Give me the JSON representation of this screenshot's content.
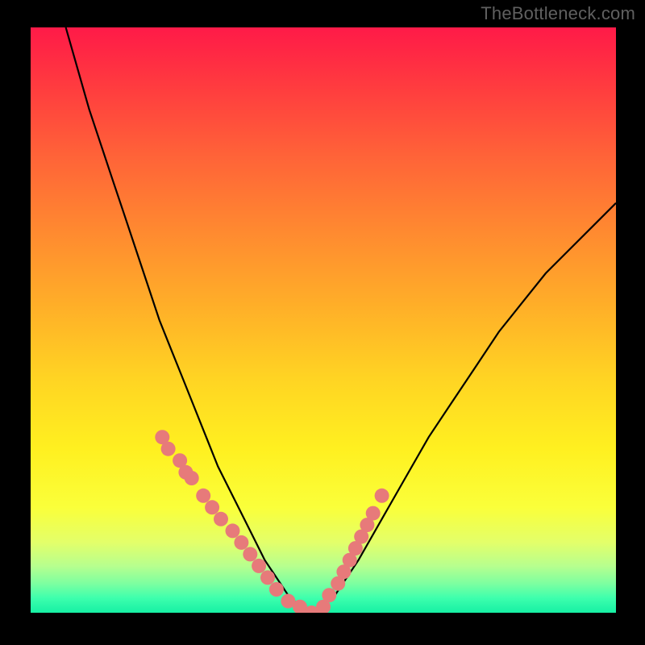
{
  "watermark": "TheBottleneck.com",
  "colors": {
    "background": "#000000",
    "curve_stroke": "#000000",
    "marker_fill": "#e77a7a",
    "gradient_top": "#ff1a48",
    "gradient_bottom": "#16f0a4"
  },
  "chart_data": {
    "type": "line",
    "title": "",
    "xlabel": "",
    "ylabel": "",
    "xlim": [
      0,
      100
    ],
    "ylim": [
      0,
      100
    ],
    "series": [
      {
        "name": "bottleneck-curve",
        "x": [
          6,
          8,
          10,
          12,
          14,
          16,
          18,
          20,
          22,
          24,
          26,
          28,
          30,
          32,
          34,
          36,
          38,
          40,
          42,
          44,
          46,
          48,
          52,
          56,
          60,
          64,
          68,
          72,
          76,
          80,
          84,
          88,
          92,
          96,
          100
        ],
        "y": [
          100,
          93,
          86,
          80,
          74,
          68,
          62,
          56,
          50,
          45,
          40,
          35,
          30,
          25,
          21,
          17,
          13,
          9,
          6,
          3,
          1,
          0,
          3,
          9,
          16,
          23,
          30,
          36,
          42,
          48,
          53,
          58,
          62,
          66,
          70
        ]
      }
    ],
    "markers": {
      "name": "highlighted-points",
      "x": [
        22.5,
        23.5,
        25.5,
        26.5,
        27.5,
        29.5,
        31.0,
        32.5,
        34.5,
        36.0,
        37.5,
        39.0,
        40.5,
        42.0,
        44.0,
        46.0,
        48.0,
        50.0,
        51.0,
        52.5,
        53.5,
        54.5,
        55.5,
        56.5,
        57.5,
        58.5,
        60.0
      ],
      "y": [
        30,
        28,
        26,
        24,
        23,
        20,
        18,
        16,
        14,
        12,
        10,
        8,
        6,
        4,
        2,
        1,
        0,
        1,
        3,
        5,
        7,
        9,
        11,
        13,
        15,
        17,
        20
      ]
    }
  }
}
